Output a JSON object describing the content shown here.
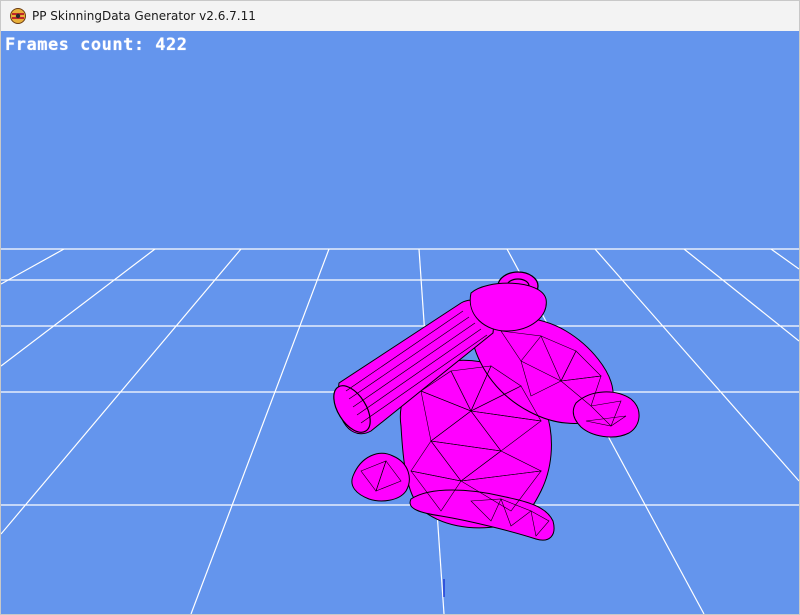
{
  "window": {
    "title": "PP SkinningData Generator v2.6.7.11",
    "icon": "app-logo-icon"
  },
  "viewport": {
    "background_color": "#6495ed",
    "grid_color": "#ffffff",
    "mesh_color": "#ff00ff",
    "wireframe_color": "#000000",
    "status_text": "Frames count: 422"
  }
}
